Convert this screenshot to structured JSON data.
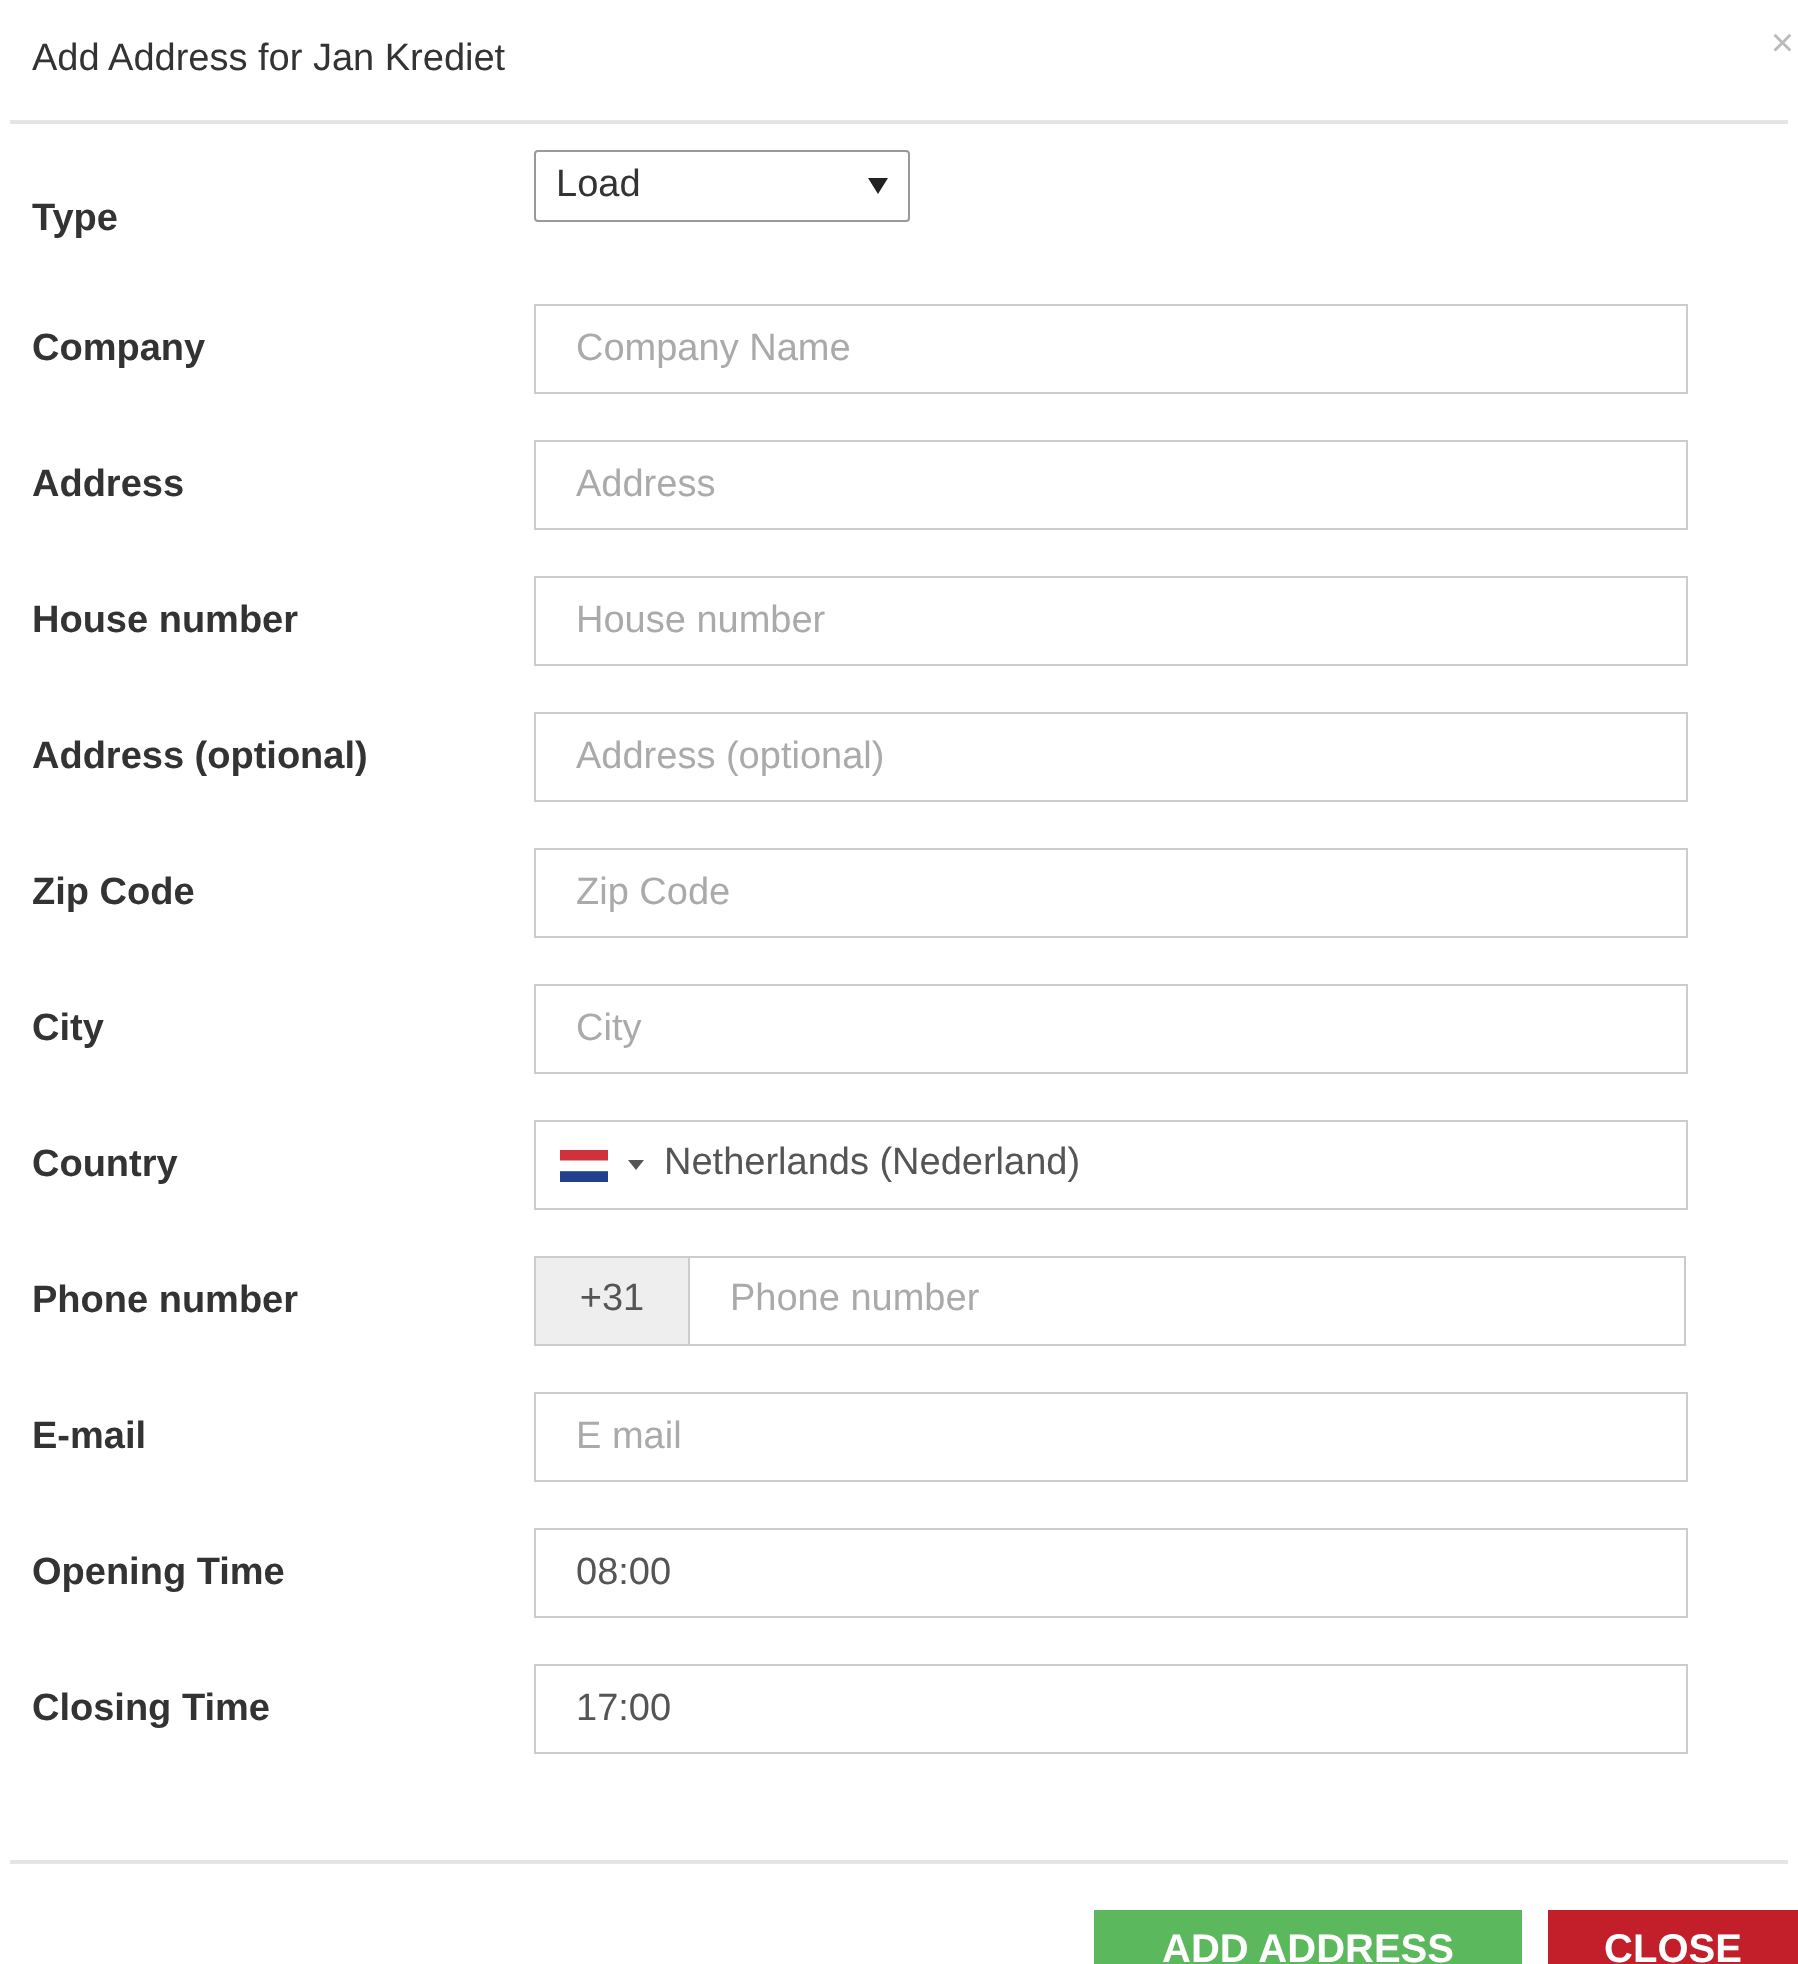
{
  "dialog": {
    "title": "Add Address for Jan Krediet",
    "close_icon": "×"
  },
  "fields": [
    {
      "kind": "select",
      "label": "Type",
      "value": "Load"
    },
    {
      "kind": "text",
      "label": "Company",
      "placeholder": "Company Name"
    },
    {
      "kind": "text",
      "label": "Address",
      "placeholder": "Address"
    },
    {
      "kind": "text",
      "label": "House number",
      "placeholder": "House number"
    },
    {
      "kind": "text",
      "label": "Address (optional)",
      "placeholder": "Address (optional)"
    },
    {
      "kind": "text",
      "label": "Zip Code",
      "placeholder": "Zip Code"
    },
    {
      "kind": "text",
      "label": "City",
      "placeholder": "City"
    },
    {
      "kind": "country",
      "label": "Country",
      "value": "Netherlands (Nederland)"
    },
    {
      "kind": "phone",
      "label": "Phone number",
      "prefix": "+31",
      "placeholder": "Phone number"
    },
    {
      "kind": "text",
      "label": "E-mail",
      "placeholder": "E mail"
    },
    {
      "kind": "text",
      "label": "Opening Time",
      "value": "08:00"
    },
    {
      "kind": "text",
      "label": "Closing Time",
      "value": "17:00"
    }
  ],
  "buttons": [
    {
      "kind": "primary",
      "label": "ADD ADDRESS"
    },
    {
      "kind": "danger",
      "label": "CLOSE"
    }
  ]
}
